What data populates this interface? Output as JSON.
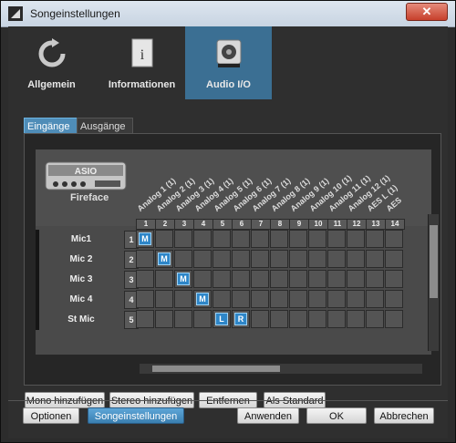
{
  "window": {
    "title": "Songeinstellungen",
    "close_glyph": "✕"
  },
  "top_tabs": [
    {
      "label": "Allgemein",
      "icon": "refresh-icon",
      "active": false
    },
    {
      "label": "Informationen",
      "icon": "info-document-icon",
      "active": false
    },
    {
      "label": "Audio I/O",
      "icon": "speaker-mic-icon",
      "active": true
    }
  ],
  "sub_tabs": [
    {
      "label": "Eingänge",
      "active": true
    },
    {
      "label": "Ausgänge",
      "active": false
    }
  ],
  "device": {
    "logo_text": "ASIO",
    "name": "Fireface"
  },
  "columns": [
    {
      "name": "Analog 1 (1)",
      "num": "1"
    },
    {
      "name": "Analog 2 (1)",
      "num": "2"
    },
    {
      "name": "Analog 3 (1)",
      "num": "3"
    },
    {
      "name": "Analog 4 (1)",
      "num": "4"
    },
    {
      "name": "Analog 5 (1)",
      "num": "5"
    },
    {
      "name": "Analog 6 (1)",
      "num": "6"
    },
    {
      "name": "Analog 7 (1)",
      "num": "7"
    },
    {
      "name": "Analog 8 (1)",
      "num": "8"
    },
    {
      "name": "Analog 9 (1)",
      "num": "9"
    },
    {
      "name": "Analog 10 (1)",
      "num": "10"
    },
    {
      "name": "Analog 11 (1)",
      "num": "11"
    },
    {
      "name": "Analog 12 (1)",
      "num": "12"
    },
    {
      "name": "AES L (1)",
      "num": "13"
    },
    {
      "name": "AES",
      "num": "14"
    }
  ],
  "rows": [
    {
      "label": "Mic1",
      "num": "1",
      "assign": [
        [
          0,
          "M"
        ]
      ]
    },
    {
      "label": "Mic 2",
      "num": "2",
      "assign": [
        [
          1,
          "M"
        ]
      ]
    },
    {
      "label": "Mic 3",
      "num": "3",
      "assign": [
        [
          2,
          "M"
        ]
      ]
    },
    {
      "label": "Mic 4",
      "num": "4",
      "assign": [
        [
          3,
          "M"
        ]
      ]
    },
    {
      "label": "St Mic",
      "num": "5",
      "assign": [
        [
          4,
          "L"
        ],
        [
          5,
          "R"
        ]
      ]
    }
  ],
  "panel_buttons": [
    "Mono hinzufügen",
    "Stereo hinzufügen",
    "Entfernen",
    "Als Standard"
  ],
  "footer_buttons": {
    "options": "Optionen",
    "song_settings": "Songeinstellungen",
    "apply": "Anwenden",
    "ok": "OK",
    "cancel": "Abbrechen"
  }
}
